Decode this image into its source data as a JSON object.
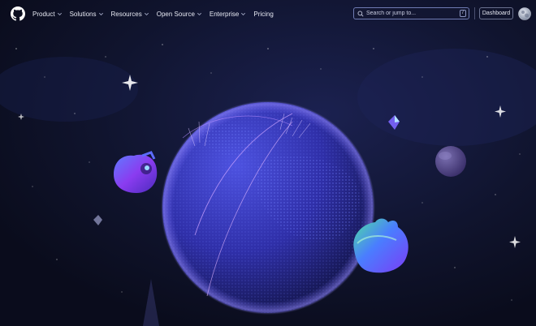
{
  "nav": {
    "items": [
      {
        "label": "Product",
        "has_caret": true
      },
      {
        "label": "Solutions",
        "has_caret": true
      },
      {
        "label": "Resources",
        "has_caret": true
      },
      {
        "label": "Open Source",
        "has_caret": true
      },
      {
        "label": "Enterprise",
        "has_caret": true
      },
      {
        "label": "Pricing",
        "has_caret": false
      }
    ]
  },
  "search": {
    "placeholder": "Search or jump to...",
    "shortcut": "/"
  },
  "header": {
    "dashboard_label": "Dashboard"
  },
  "icons": {
    "logo": "github-logo-icon",
    "search": "search-icon",
    "avatar": "user-avatar"
  },
  "colors": {
    "background": "#0d1023",
    "globe": "#3a3fc4",
    "accent_purple": "#8b6cf0"
  }
}
